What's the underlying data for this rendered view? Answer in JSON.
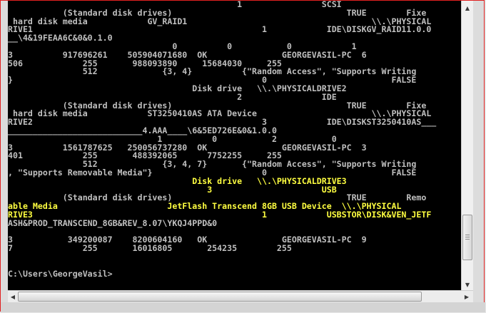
{
  "console": {
    "lines": [
      {
        "text": "                                              1                SCSI",
        "style": "w"
      },
      {
        "text": "           (Standard disk drives)                                   TRUE        Fixe",
        "style": "w"
      },
      {
        "text": " hard disk media            GV_RAID1                                     \\\\.\\PHYSICAL",
        "style": "w"
      },
      {
        "text": "RIVE1                                              1            IDE\\DISKGV_RAID11.0.0",
        "style": "w"
      },
      {
        "text": "__\\4&19FEAA6C&0&0.1.0",
        "style": "w"
      },
      {
        "text": "                                 0          0           0            1",
        "style": "w"
      },
      {
        "text": "3          917696261    505904071680  OK               GEORGEVASIL-PC  6",
        "style": "w"
      },
      {
        "text": "506            255       988093890     15684030     255",
        "style": "w"
      },
      {
        "text": "               512             {3, 4}          {\"Random Access\", \"Supports Writing",
        "style": "w"
      },
      {
        "text": "}                                                  0                         FALSE",
        "style": "w"
      },
      {
        "text": "                                     Disk drive   \\\\.\\PHYSICALDRIVE2",
        "style": "w"
      },
      {
        "text": "                                              2                IDE",
        "style": "w"
      },
      {
        "text": "           (Standard disk drives)                                   TRUE        Fixe",
        "style": "w"
      },
      {
        "text": " hard disk media            ST3250410AS ATA Device                       \\\\.\\PHYSICAL",
        "style": "w"
      },
      {
        "text": "RIVE2                                              3            IDE\\DISKST3250410AS___",
        "style": "w"
      },
      {
        "text": "___________________________4.AAA____\\6&5ED726E&0&1.0.0",
        "style": "w"
      },
      {
        "text": "                              1          0           2           0",
        "style": "w"
      },
      {
        "text": "3          1561787625   250056737280  OK               GEORGEVASIL-PC  3",
        "style": "w"
      },
      {
        "text": "401            255       488392065      7752255     255",
        "style": "w"
      },
      {
        "text": "               512             {3, 4, 7}       {\"Random Access\", \"Supports Writing",
        "style": "w"
      },
      {
        "text": ", \"Supports Removable Media\"}                      0                         FALSE",
        "style": "w"
      },
      {
        "text": "                                     Disk drive   \\\\.\\PHYSICALDRIVE3",
        "style": "y"
      },
      {
        "text": "                                        3                      USB",
        "style": "y"
      },
      {
        "text": "           (Standard disk drives)                                   TRUE        Remo",
        "style": "w"
      },
      {
        "text": "able Media                      JetFlash Transcend 8GB USB Device  \\\\.\\PHYSICAL",
        "style": "y"
      },
      {
        "text": "RIVE3                                              1            USBSTOR\\DISK&VEN_JETF",
        "style": "y"
      },
      {
        "text": "ASH&PROD_TRANSCEND_8GB&REV_8.07\\YKQJ4PPD&0",
        "style": "w"
      },
      {
        "text": "",
        "style": "w"
      },
      {
        "text": "3           349200087    8200604160   OK               GEORGEVASIL-PC  9",
        "style": "w"
      },
      {
        "text": "7              255       16016805       254235        255",
        "style": "w"
      },
      {
        "text": "",
        "style": "w"
      },
      {
        "text": "",
        "style": "w"
      },
      {
        "text": "C:\\Users\\GeorgeVasil>",
        "style": "w"
      }
    ]
  },
  "scrollbar": {
    "up_arrow": "▲",
    "down_arrow": "▼",
    "left_arrow": "◀",
    "right_arrow": "▶"
  },
  "colors": {
    "console_background": "#000000",
    "console_text": "#c0c0c0",
    "highlight_text": "#ffff40",
    "window_border": "#e02020"
  }
}
